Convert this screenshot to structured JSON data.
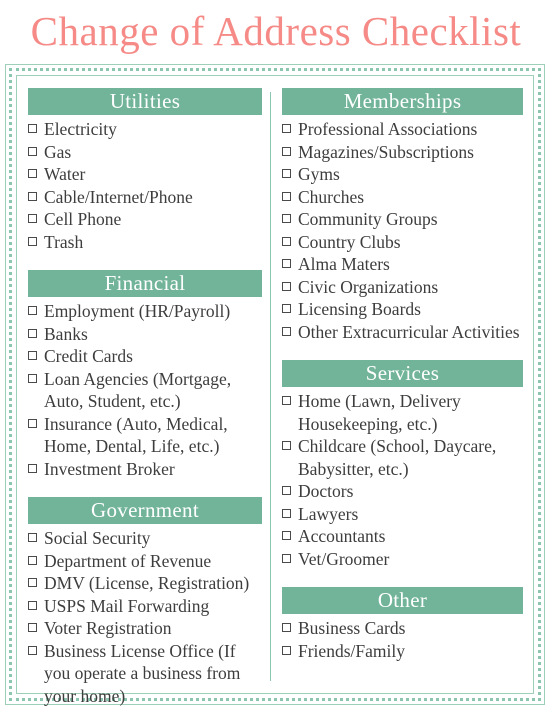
{
  "title": "Change of Address Checklist",
  "colors": {
    "title_text": "#f58a87",
    "header_bar": "#72b49a",
    "header_text": "#ffffff",
    "border": "#8dc6ae",
    "item_text": "#3d3d3d"
  },
  "columns": [
    {
      "name": "left",
      "sections": [
        {
          "heading": "Utilities",
          "items": [
            "Electricity",
            "Gas",
            "Water",
            "Cable/Internet/Phone",
            "Cell Phone",
            "Trash"
          ]
        },
        {
          "heading": "Financial",
          "items": [
            "Employment (HR/Payroll)",
            "Banks",
            "Credit Cards",
            "Loan Agencies (Mortgage, Auto, Student, etc.)",
            "Insurance (Auto, Medical, Home, Dental, Life, etc.)",
            "Investment Broker"
          ]
        },
        {
          "heading": "Government",
          "items": [
            "Social Security",
            "Department of Revenue",
            "DMV (License, Registration)",
            "USPS Mail Forwarding",
            "Voter Registration",
            "Business License Office (If you operate a business from your home)"
          ]
        }
      ]
    },
    {
      "name": "right",
      "sections": [
        {
          "heading": "Memberships",
          "items": [
            "Professional Associations",
            "Magazines/Subscriptions",
            "Gyms",
            "Churches",
            "Community Groups",
            "Country Clubs",
            "Alma Maters",
            "Civic Organizations",
            "Licensing Boards",
            "Other Extracurricular Activities"
          ]
        },
        {
          "heading": "Services",
          "items": [
            "Home (Lawn, Delivery Housekeeping, etc.)",
            "Childcare (School, Daycare, Babysitter, etc.)",
            "Doctors",
            "Lawyers",
            "Accountants",
            "Vet/Groomer"
          ]
        },
        {
          "heading": "Other",
          "items": [
            "Business Cards",
            "Friends/Family"
          ]
        }
      ]
    }
  ]
}
